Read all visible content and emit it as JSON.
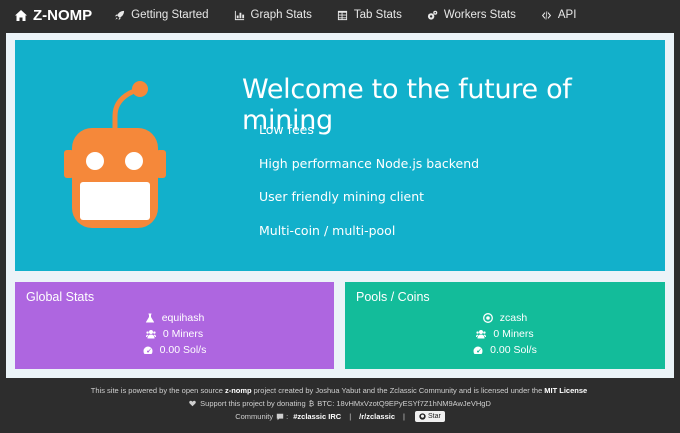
{
  "nav": {
    "brand": "Z-NOMP",
    "items": [
      {
        "label": "Getting Started",
        "icon": "rocket-icon"
      },
      {
        "label": "Graph Stats",
        "icon": "bar-chart-icon"
      },
      {
        "label": "Tab Stats",
        "icon": "table-icon"
      },
      {
        "label": "Workers Stats",
        "icon": "gears-icon"
      },
      {
        "label": "API",
        "icon": "code-icon"
      }
    ]
  },
  "hero": {
    "title": "Welcome to the future of mining",
    "features": [
      "Low fees",
      "High performance Node.js backend",
      "User friendly mining client",
      "Multi-coin / multi-pool"
    ]
  },
  "global_stats": {
    "title": "Global Stats",
    "algorithm": "equihash",
    "miners": "0 Miners",
    "hashrate": "0.00 Sol/s"
  },
  "pools": {
    "title": "Pools / Coins",
    "coin": "zcash",
    "miners": "0 Miners",
    "hashrate": "0.00 Sol/s"
  },
  "footer": {
    "line1_pre": "This site is powered by the open source",
    "line1_project": "z-nomp",
    "line1_mid": "project created by Joshua Yabut and the Zclassic Community and is licensed under the",
    "line1_license": "MIT License",
    "line2_pre": "Support this project by donating",
    "line2_btc": "BTC: 18vHMxVzotQ9EPyESYf7Z1hNM9AwJeVHgD",
    "line3_pre": "Community",
    "line3_irc": "#zclassic IRC",
    "line3_reddit": "/r/zclassic",
    "star_label": "Star"
  },
  "colors": {
    "navbar": "#2d2d2d",
    "hero": "#12b0cb",
    "global_card": "#ae66e0",
    "pools_card": "#13bc9a",
    "robot": "#f5883a"
  }
}
